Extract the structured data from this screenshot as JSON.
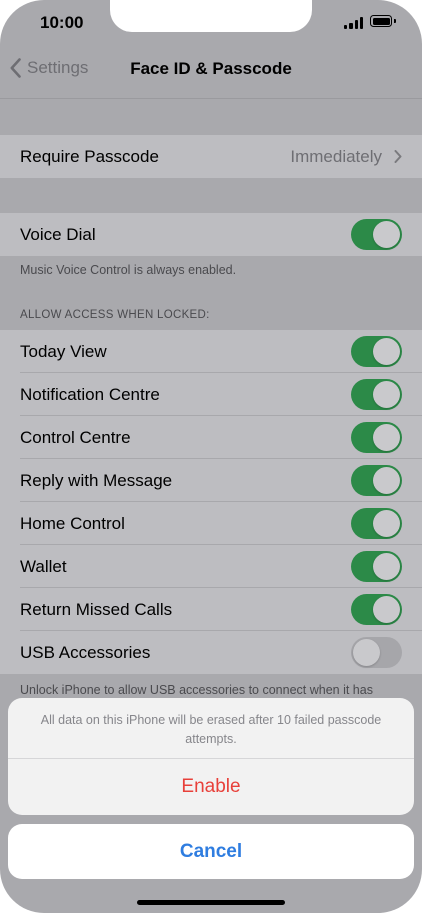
{
  "status_bar": {
    "time": "10:00"
  },
  "nav": {
    "back_label": "Settings",
    "title": "Face ID & Passcode"
  },
  "require_passcode": {
    "label": "Require Passcode",
    "value": "Immediately"
  },
  "voice_dial": {
    "label": "Voice Dial",
    "enabled": true,
    "footnote": "Music Voice Control is always enabled."
  },
  "locked_access": {
    "header": "ALLOW ACCESS WHEN LOCKED:",
    "items": [
      {
        "label": "Today View",
        "enabled": true
      },
      {
        "label": "Notification Centre",
        "enabled": true
      },
      {
        "label": "Control Centre",
        "enabled": true
      },
      {
        "label": "Reply with Message",
        "enabled": true
      },
      {
        "label": "Home Control",
        "enabled": true
      },
      {
        "label": "Wallet",
        "enabled": true
      },
      {
        "label": "Return Missed Calls",
        "enabled": true
      },
      {
        "label": "USB Accessories",
        "enabled": false
      }
    ],
    "footnote": "Unlock iPhone to allow USB accessories to connect when it has"
  },
  "action_sheet": {
    "message": "All data on this iPhone will be erased after 10 failed passcode attempts.",
    "enable_label": "Enable",
    "cancel_label": "Cancel"
  },
  "colors": {
    "toggle_on": "#2c8a48",
    "enable_text": "#e8403a",
    "cancel_text": "#2f7de0"
  }
}
